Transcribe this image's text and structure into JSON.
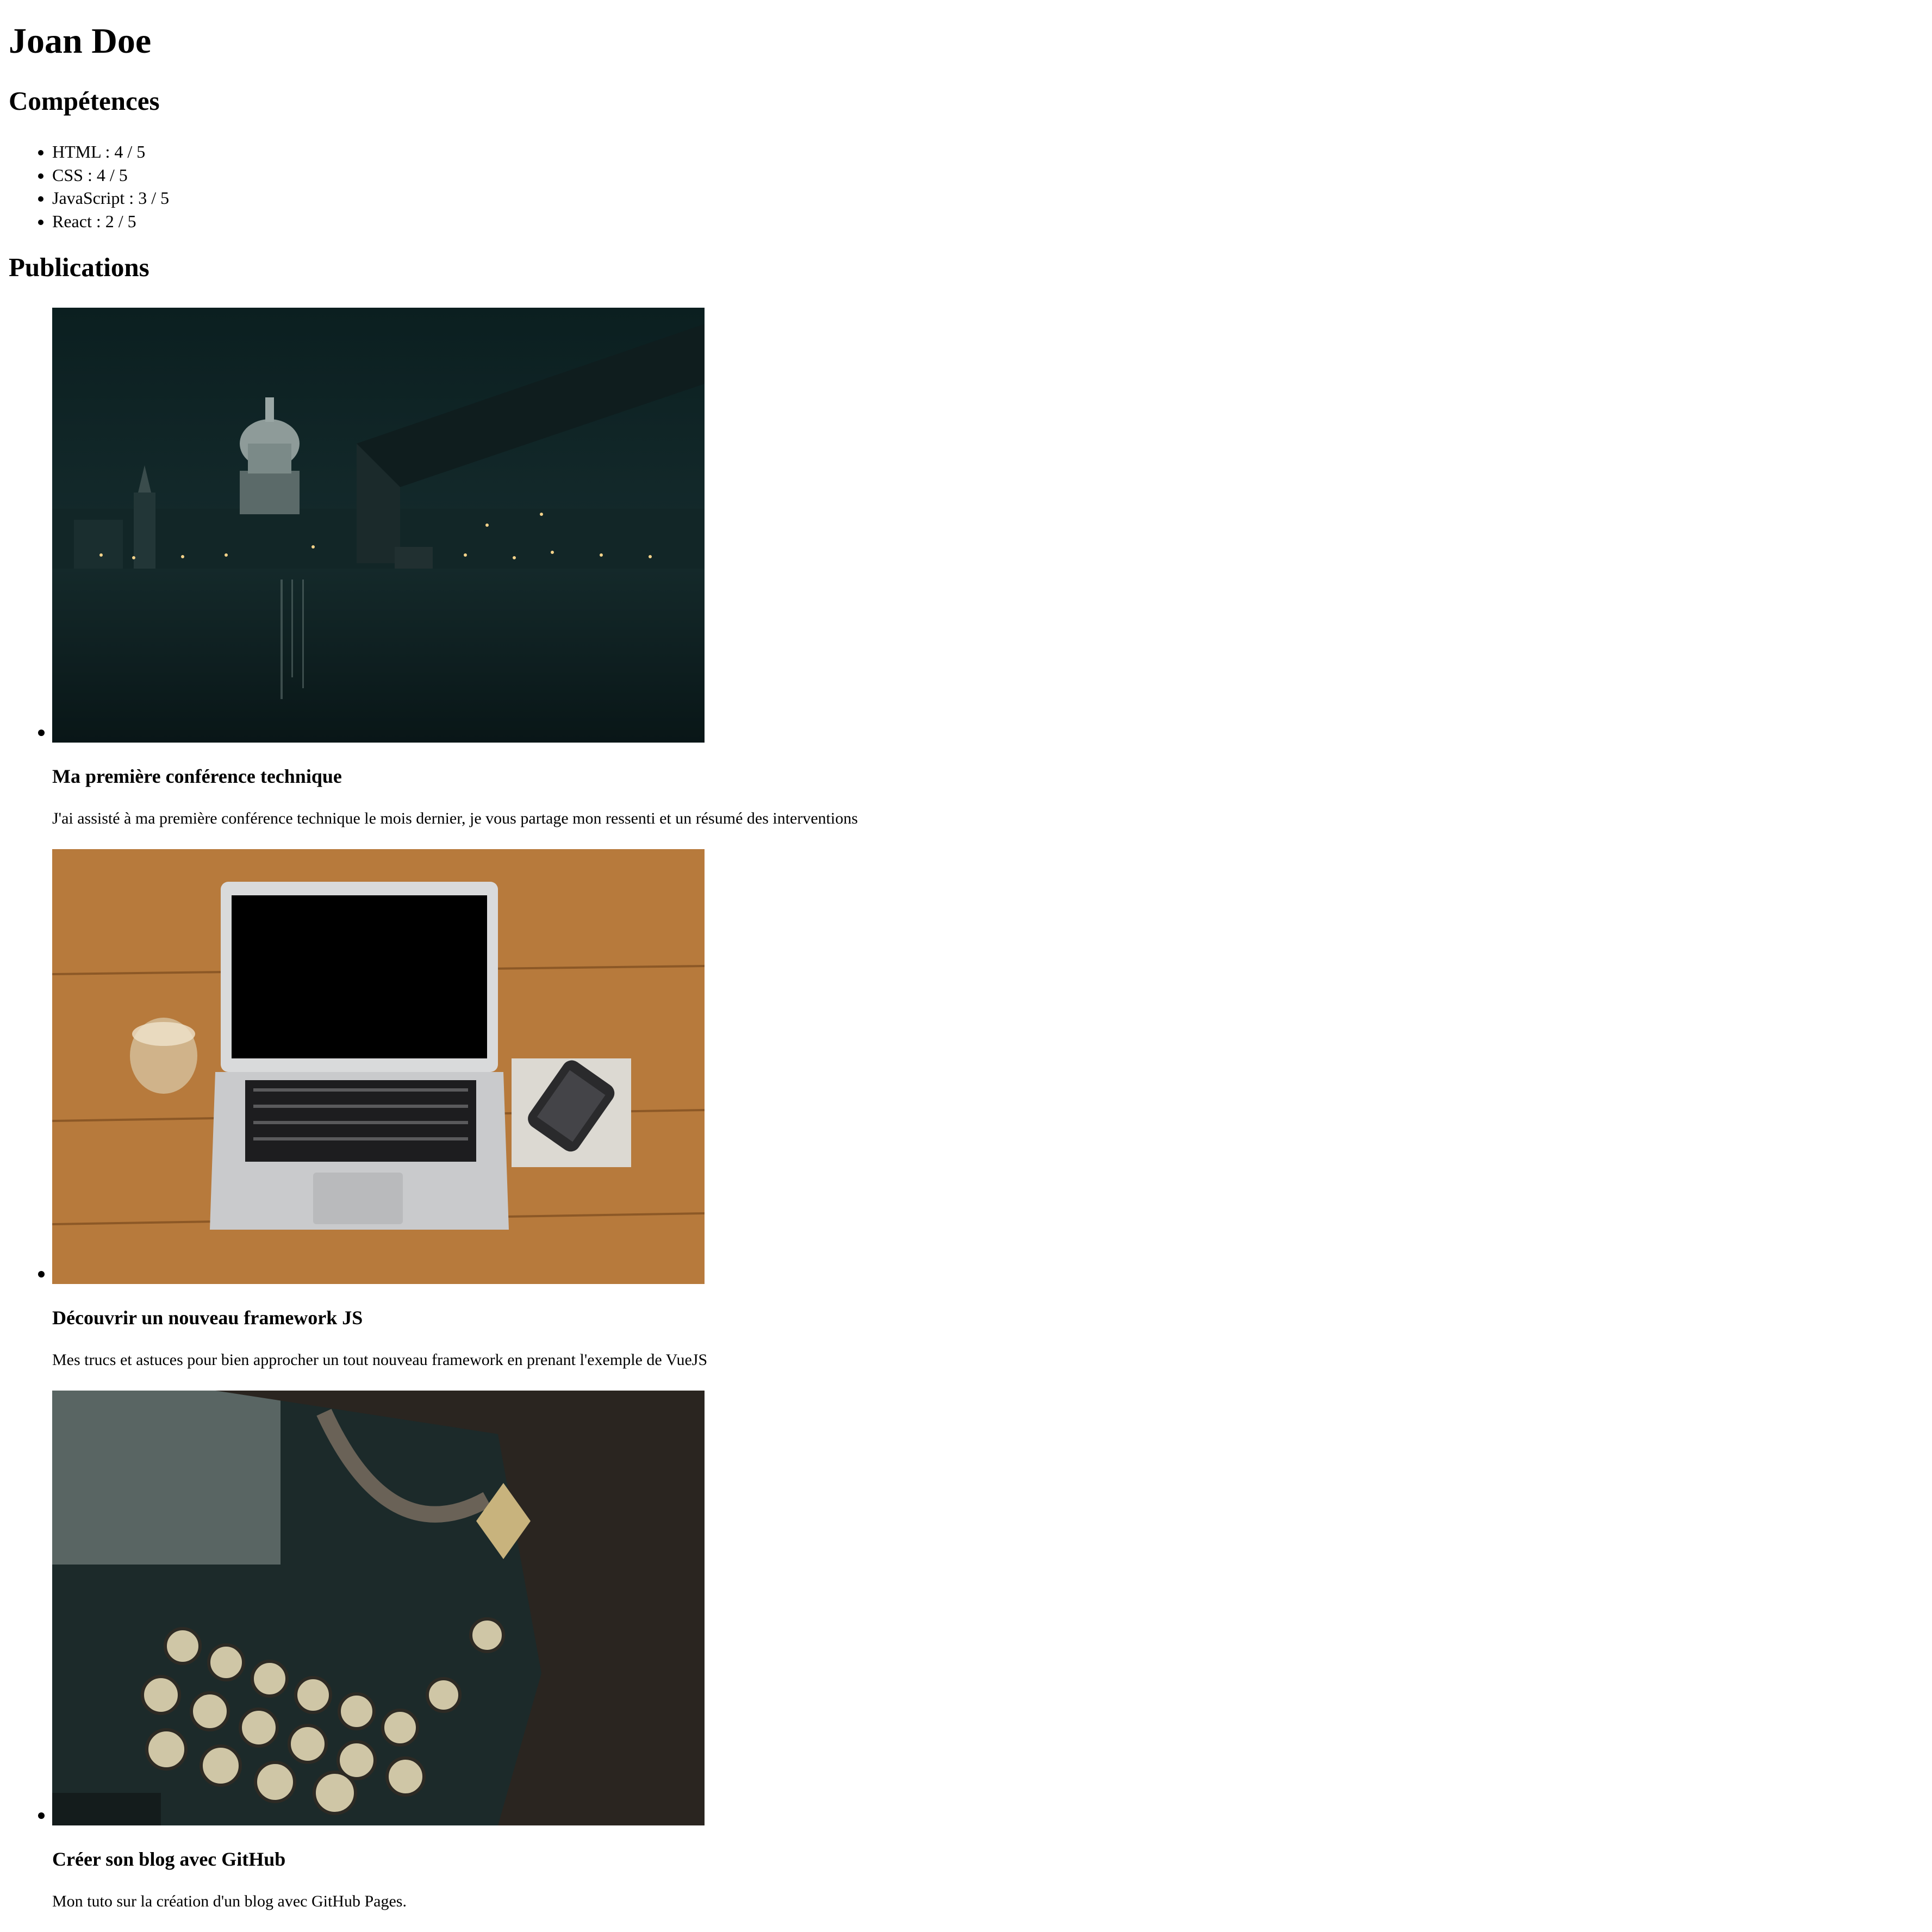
{
  "header": {
    "name": "Joan Doe"
  },
  "skills": {
    "title": "Compétences",
    "items": [
      {
        "label": "HTML : 4 / 5"
      },
      {
        "label": "CSS : 4 / 5"
      },
      {
        "label": "JavaScript : 3 / 5"
      },
      {
        "label": "React : 2 / 5"
      }
    ]
  },
  "publications": {
    "title": "Publications",
    "items": [
      {
        "title": "Ma première conférence technique",
        "description": "J'ai assisté à ma première conférence technique le mois dernier, je vous partage mon ressenti et un résumé des interventions"
      },
      {
        "title": "Découvrir un nouveau framework JS",
        "description": "Mes trucs et astuces pour bien approcher un tout nouveau framework en prenant l'exemple de VueJS"
      },
      {
        "title": "Créer son blog avec GitHub",
        "description": "Mon tuto sur la création d'un blog avec GitHub Pages."
      }
    ]
  },
  "colors": {
    "text": "#000000",
    "background": "#ffffff"
  }
}
